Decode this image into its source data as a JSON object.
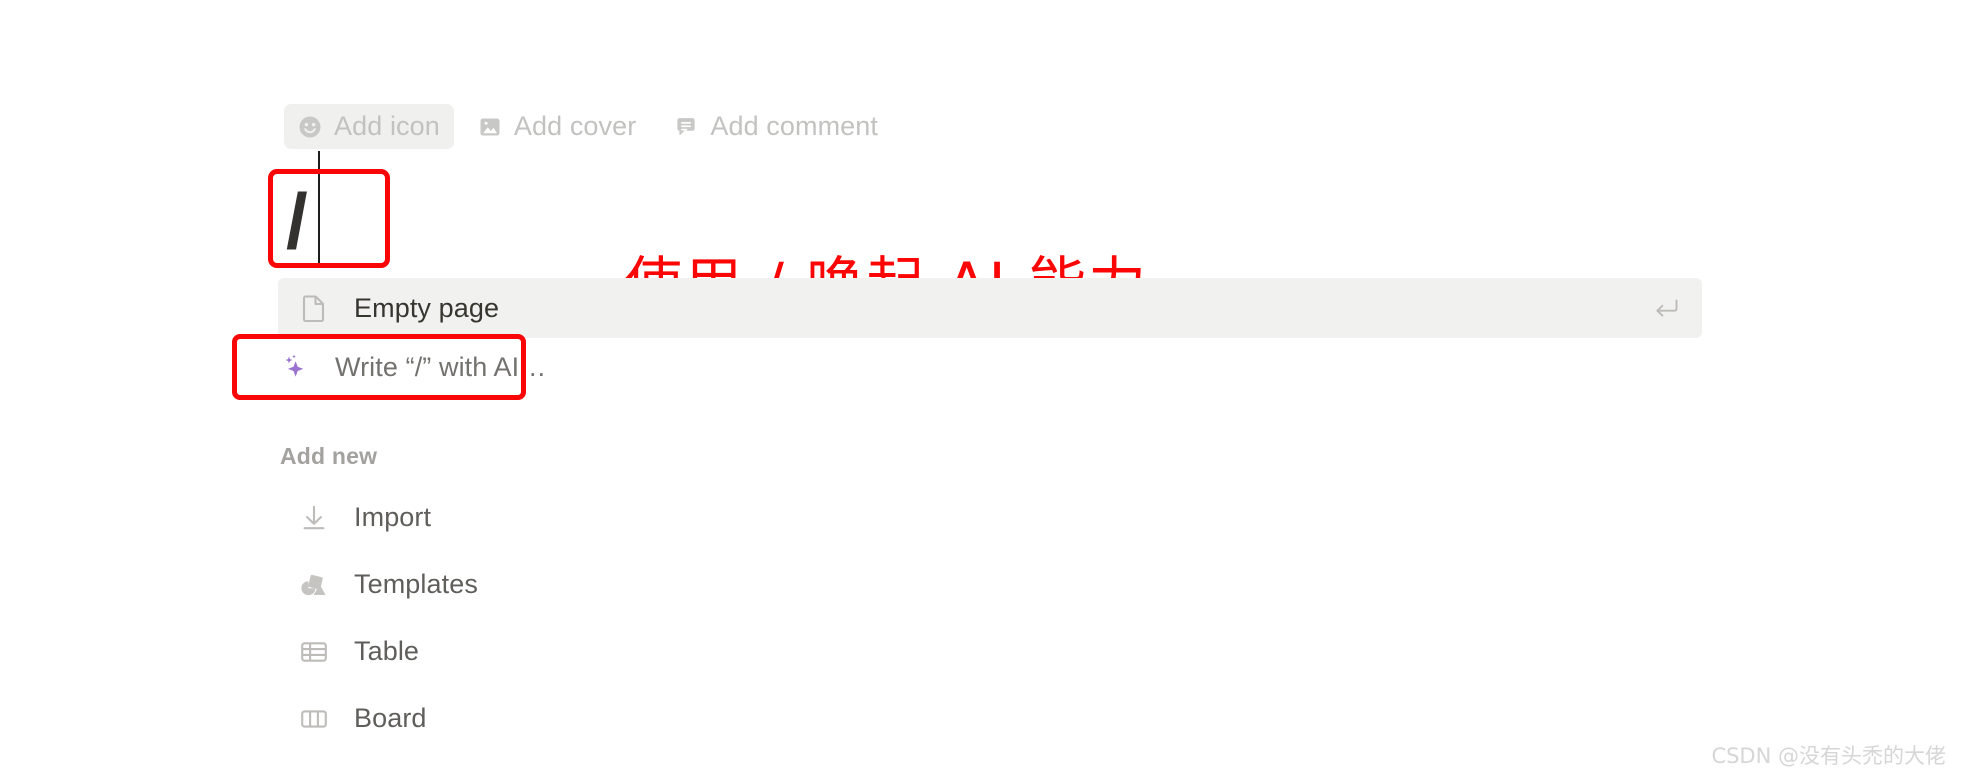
{
  "toolbar": {
    "buttons": [
      {
        "label": "Add icon",
        "icon": "smiley-icon",
        "hovered": true
      },
      {
        "label": "Add cover",
        "icon": "image-icon",
        "hovered": false
      },
      {
        "label": "Add comment",
        "icon": "speech-bubble-icon",
        "hovered": false
      }
    ]
  },
  "title": {
    "value": "/",
    "caret_visible": true
  },
  "slash_menu": {
    "items": [
      {
        "label": "Empty page",
        "icon": "document-page-icon",
        "selected": true,
        "shortcut_icon": "enter-key-icon"
      },
      {
        "label": "Write “/” with AI…",
        "icon": "ai-sparkle-icon",
        "selected": false,
        "shortcut_icon": ""
      }
    ]
  },
  "add_new": {
    "section_label": "Add new",
    "items": [
      {
        "label": "Import",
        "icon": "download-arrow-icon"
      },
      {
        "label": "Templates",
        "icon": "templates-shapes-icon"
      },
      {
        "label": "Table",
        "icon": "table-grid-icon"
      },
      {
        "label": "Board",
        "icon": "kanban-board-icon"
      }
    ]
  },
  "annotations": {
    "chinese_note": "使用 / 唤起 AI 能力",
    "highlight_color": "#f90606"
  },
  "watermark": {
    "text": "CSDN @没有头禿的大佬"
  },
  "colors": {
    "accent_purple": "#9a72d0",
    "row_highlight": "#f1f1ef",
    "annotation_red": "#f90606",
    "muted_gray": "#c2c2c0"
  }
}
